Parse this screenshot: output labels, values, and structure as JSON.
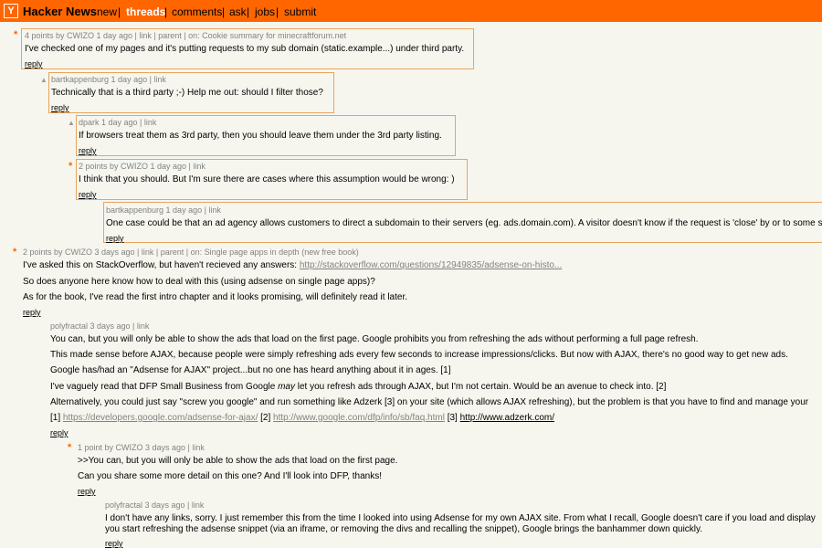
{
  "header": {
    "logo": "Y",
    "brand": "Hacker News",
    "nav": [
      "new",
      "threads",
      "comments",
      "ask",
      "jobs",
      "submit"
    ],
    "separator": "|"
  },
  "comments": {
    "c1": {
      "meta": "4 points by CWIZO 1 day ago | link | parent | on: Cookie summary for minecraftforum.net",
      "text": "I've checked one of my pages and it's putting requests to my sub domain (static.example...) under third party.",
      "reply": "reply"
    },
    "c2": {
      "meta": "bartkappenburg 1 day ago | link",
      "text": "Technically that is a third party ;-) Help me out: should I filter those?",
      "reply": "reply"
    },
    "c3": {
      "meta": "dpark 1 day ago | link",
      "text": "If browsers treat them as 3rd party, then you should leave them under the 3rd party listing.",
      "reply": "reply"
    },
    "c4": {
      "meta": "2 points by CWIZO 1 day ago | link",
      "text": "I think that you should. But I'm sure there are cases where this assumption would be wrong: )",
      "reply": "reply"
    },
    "c5": {
      "meta": "bartkappenburg 1 day ago | link",
      "text": "One case could be that an ad agency allows customers to direct a subdomain to their servers (eg. ads.domain.com). A visitor doesn't know if the request is 'close' by or to some s",
      "reply": "reply"
    },
    "c6": {
      "meta": "2 points by CWIZO 3 days ago | link | parent | on: Single page apps in depth (new free book)",
      "p1_prefix": "I've asked this on StackOverflow, but haven't recieved any answers: ",
      "p1_link": "http://stackoverflow.com/questions/12949835/adsense-on-histo...",
      "p2": "So does anyone here know how to deal with this (using adsense on single page apps)?",
      "p3": "As for the book, I've read the first intro chapter and it looks promising, will definitely read it later.",
      "reply": "reply"
    },
    "c7": {
      "meta": "polyfractal 3 days ago | link",
      "p1": "You can, but you will only be able to show the ads that load on the first page. Google prohibits you from refreshing the ads without performing a full page refresh.",
      "p2": "This made sense before AJAX, because people were simply refreshing ads every few seconds to increase impressions/clicks. But now with AJAX, there's no good way to get new ads.",
      "p3": "Google has/had an \"Adsense for AJAX\" project...but no one has heard anything about it in ages. [1]",
      "p4_a": "I've vaguely read that DFP Small Business from Google ",
      "p4_em": "may",
      "p4_b": " let you refresh ads through AJAX, but I'm not certain. Would be an avenue to check into. [2]",
      "p5": "Alternatively, you could just say \"screw you google\" and run something like Adzerk [3] on your site (which allows AJAX refreshing), but the problem is that you have to find and manage your",
      "refs": {
        "r1": "[1] ",
        "l1": "https://developers.google.com/adsense-for-ajax/",
        "r2": " [2] ",
        "l2": "http://www.google.com/dfp/info/sb/faq.html",
        "r3": " [3] ",
        "l3": "http://www.adzerk.com/"
      },
      "reply": "reply"
    },
    "c8": {
      "meta": "1 point by CWIZO 3 days ago | link",
      "p1": ">>You can, but you will only be able to show the ads that load on the first page.",
      "p2": "Can you share some more detail on this one? And I'll look into DFP, thanks!",
      "reply": "reply"
    },
    "c9": {
      "meta": "polyfractal 3 days ago | link",
      "p1": "I don't have any links, sorry. I just remember this from the time I looked into using Adsense for my own AJAX site. From what I recall, Google doesn't care if you load and display",
      "p2": "you start refreshing the adsense snippet (via an iframe, or removing the divs and recalling the snippet), Google brings the banhammer down quickly.",
      "reply": "reply"
    }
  },
  "marks": {
    "star": "*",
    "up": "▲"
  },
  "colors": {
    "header": "#ff6600",
    "background": "#f6f6ef",
    "highlight_border": "#e8a45c",
    "meta_text": "#828282"
  }
}
